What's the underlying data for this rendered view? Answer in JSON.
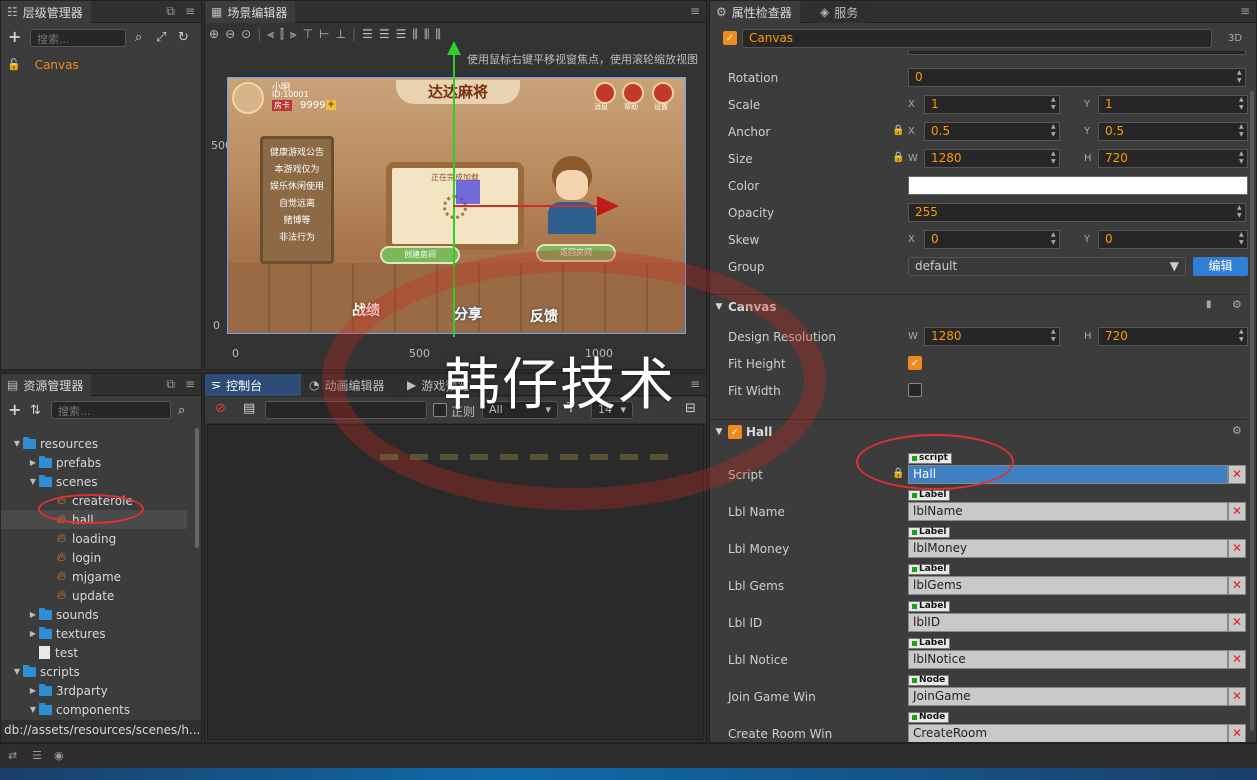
{
  "hierarchy": {
    "title": "层级管理器",
    "search_placeholder": "搜索...",
    "root_node": "Canvas"
  },
  "scene": {
    "title": "场景编辑器",
    "hint": "使用鼠标右键平移视窗焦点，使用滚轮缩放视图",
    "ruler_y": [
      "500",
      "0"
    ],
    "ruler_x": [
      "0",
      "500",
      "1000"
    ],
    "game": {
      "title": "达达麻将",
      "player_name": "小明",
      "player_id": "ID:10001",
      "card_label": "房卡",
      "card_count": "9999",
      "top_buttons": [
        "消息",
        "帮助",
        "设置"
      ],
      "notice_title": "健康游戏公告",
      "notice_lines": [
        "本游戏仅为",
        "娱乐休闲使用",
        "自觉远离",
        "赌博等",
        "非法行为"
      ],
      "board_text": "正在完成加载",
      "create_room": "创建房间",
      "return_room": "返回房间",
      "bottom_buttons": [
        "战绩",
        "分享",
        "反馈"
      ]
    }
  },
  "watermark": "韩仔技术",
  "assets": {
    "title": "资源管理器",
    "search_placeholder": "搜索...",
    "tree": [
      {
        "label": "resources",
        "depth": 1,
        "kind": "folder",
        "open": true
      },
      {
        "label": "prefabs",
        "depth": 2,
        "kind": "folder",
        "open": false
      },
      {
        "label": "scenes",
        "depth": 2,
        "kind": "folder",
        "open": true
      },
      {
        "label": "createrole",
        "depth": 3,
        "kind": "scene"
      },
      {
        "label": "hall",
        "depth": 3,
        "kind": "scene",
        "selected": true
      },
      {
        "label": "loading",
        "depth": 3,
        "kind": "scene"
      },
      {
        "label": "login",
        "depth": 3,
        "kind": "scene"
      },
      {
        "label": "mjgame",
        "depth": 3,
        "kind": "scene"
      },
      {
        "label": "update",
        "depth": 3,
        "kind": "scene"
      },
      {
        "label": "sounds",
        "depth": 2,
        "kind": "folder",
        "open": false
      },
      {
        "label": "textures",
        "depth": 2,
        "kind": "folder",
        "open": false
      },
      {
        "label": "test",
        "depth": 2,
        "kind": "file"
      },
      {
        "label": "scripts",
        "depth": 1,
        "kind": "folder",
        "open": true
      },
      {
        "label": "3rdparty",
        "depth": 2,
        "kind": "folder",
        "open": false
      },
      {
        "label": "components",
        "depth": 2,
        "kind": "folder",
        "open": true
      }
    ],
    "path": "db://assets/resources/scenes/h..."
  },
  "console": {
    "tabs": [
      "控制台",
      "动画编辑器",
      "游戏预览"
    ],
    "regex_label": "正则",
    "level_filter": "All",
    "font_size": "14"
  },
  "inspector": {
    "title": "属性检查器",
    "services_tab": "服务",
    "node_name": "Canvas",
    "badge_3d": "3D",
    "rows": [
      {
        "label": "Rotation",
        "value": "0"
      },
      {
        "label": "Scale",
        "x": "1",
        "y": "1"
      },
      {
        "label": "Anchor",
        "x": "0.5",
        "y": "0.5"
      },
      {
        "label": "Size",
        "w": "1280",
        "h": "720"
      },
      {
        "label": "Color"
      },
      {
        "label": "Opacity",
        "value": "255"
      },
      {
        "label": "Skew",
        "x": "0",
        "y": "0"
      },
      {
        "label": "Group",
        "value": "default",
        "button": "编辑"
      }
    ],
    "canvas_section": "Canvas",
    "design_resolution": {
      "label": "Design Resolution",
      "w": "1280",
      "h": "720"
    },
    "fit_height": {
      "label": "Fit Height",
      "checked": true
    },
    "fit_width": {
      "label": "Fit Width",
      "checked": false
    },
    "hall_section": "Hall",
    "refs": [
      {
        "label": "Script",
        "type": "script",
        "value": "Hall"
      },
      {
        "label": "Lbl Name",
        "type": "Label",
        "value": "lblName"
      },
      {
        "label": "Lbl Money",
        "type": "Label",
        "value": "lblMoney"
      },
      {
        "label": "Lbl Gems",
        "type": "Label",
        "value": "lblGems"
      },
      {
        "label": "Lbl ID",
        "type": "Label",
        "value": "lblID"
      },
      {
        "label": "Lbl Notice",
        "type": "Label",
        "value": "lblNotice"
      },
      {
        "label": "Join Game Win",
        "type": "Node",
        "value": "JoinGame"
      },
      {
        "label": "Create Room Win",
        "type": "Node",
        "value": "CreateRoom"
      }
    ],
    "axis": {
      "x": "X",
      "y": "Y",
      "w": "W",
      "h": "H"
    }
  },
  "colors": {
    "accent": "#f08a1e",
    "selection": "#2d4d78",
    "annotation": "#e03030"
  }
}
